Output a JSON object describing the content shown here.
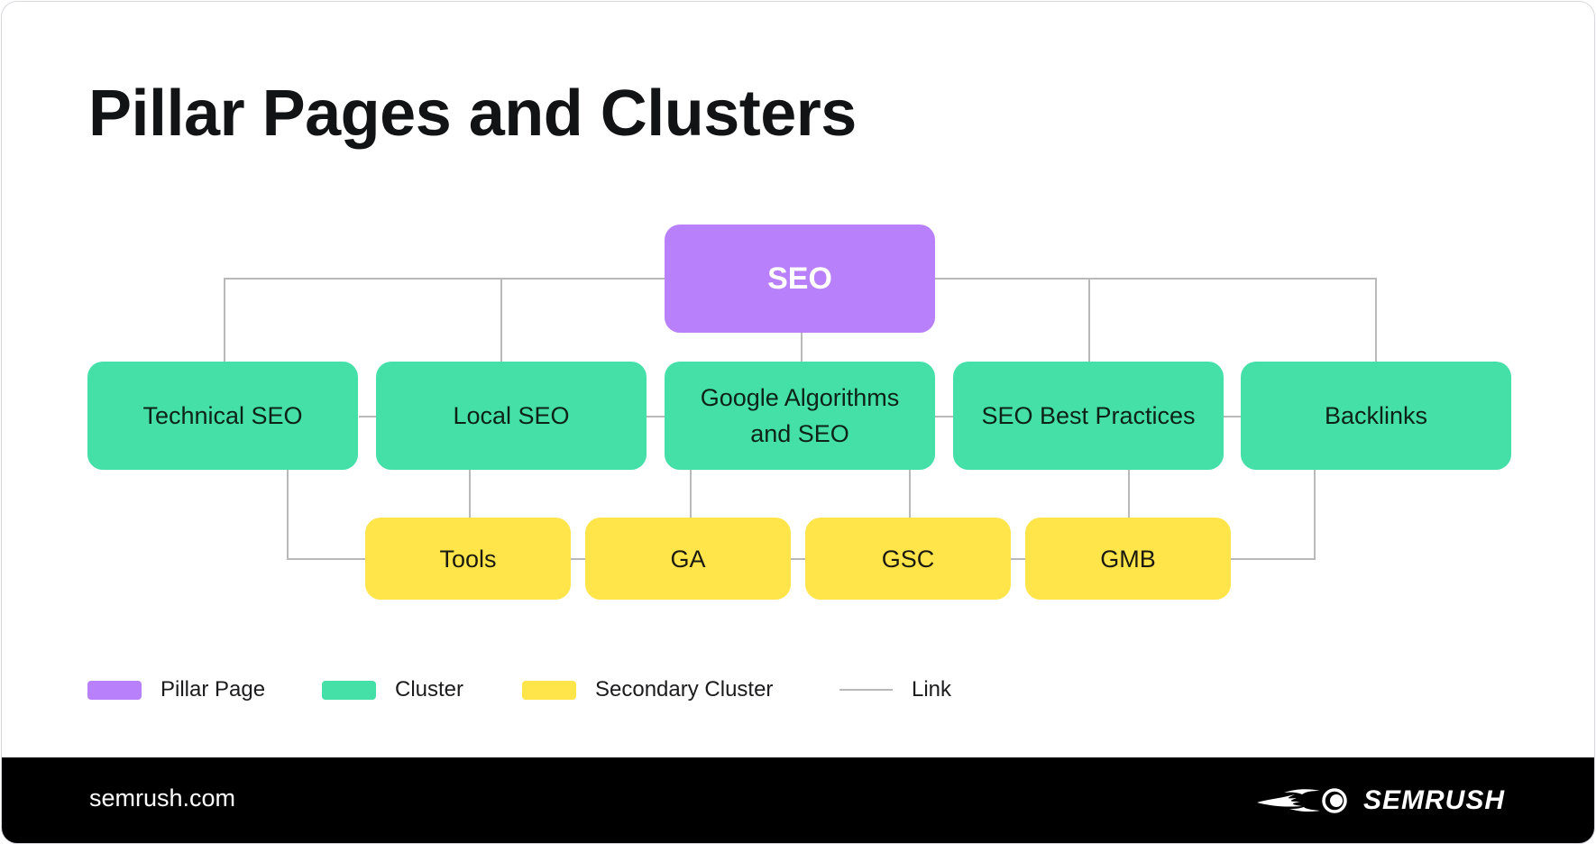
{
  "title": "Pillar Pages and Clusters",
  "colors": {
    "pillar": "#b880fb",
    "cluster": "#45e0a7",
    "secondary": "#ffe54a",
    "link": "#b9b9b9",
    "footer": "#000000"
  },
  "pillar": {
    "label": "SEO"
  },
  "clusters": [
    {
      "label": "Technical SEO"
    },
    {
      "label": "Local SEO"
    },
    {
      "label": "Google Algorithms",
      "label2": "and SEO"
    },
    {
      "label": "SEO Best Practices"
    },
    {
      "label": "Backlinks"
    }
  ],
  "secondary_clusters": [
    {
      "label": "Tools"
    },
    {
      "label": "GA"
    },
    {
      "label": "GSC"
    },
    {
      "label": "GMB"
    }
  ],
  "links": [
    {
      "from": "SEO",
      "to": "Technical SEO"
    },
    {
      "from": "SEO",
      "to": "Local SEO"
    },
    {
      "from": "SEO",
      "to": "Google Algorithms and SEO"
    },
    {
      "from": "SEO",
      "to": "SEO Best Practices"
    },
    {
      "from": "SEO",
      "to": "Backlinks"
    },
    {
      "from": "Technical SEO",
      "to": "Local SEO"
    },
    {
      "from": "Local SEO",
      "to": "Google Algorithms and SEO"
    },
    {
      "from": "Google Algorithms and SEO",
      "to": "SEO Best Practices"
    },
    {
      "from": "SEO Best Practices",
      "to": "Backlinks"
    },
    {
      "from": "Technical SEO",
      "to": "Tools"
    },
    {
      "from": "Local SEO",
      "to": "Tools"
    },
    {
      "from": "Google Algorithms and SEO",
      "to": "GA"
    },
    {
      "from": "Google Algorithms and SEO",
      "to": "GSC"
    },
    {
      "from": "SEO Best Practices",
      "to": "GMB"
    },
    {
      "from": "Backlinks",
      "to": "GMB"
    },
    {
      "from": "Tools",
      "to": "GA"
    },
    {
      "from": "GA",
      "to": "GSC"
    },
    {
      "from": "GSC",
      "to": "GMB"
    }
  ],
  "legend": [
    {
      "label": "Pillar Page",
      "kind": "swatch",
      "color": "#b880fb"
    },
    {
      "label": "Cluster",
      "kind": "swatch",
      "color": "#45e0a7"
    },
    {
      "label": "Secondary Cluster",
      "kind": "swatch",
      "color": "#ffe54a"
    },
    {
      "label": "Link",
      "kind": "line",
      "color": "#b9b9b9"
    }
  ],
  "footer": {
    "url": "semrush.com",
    "logo_text": "SEMRUSH",
    "logo_icon": "semrush-fireball-icon"
  }
}
